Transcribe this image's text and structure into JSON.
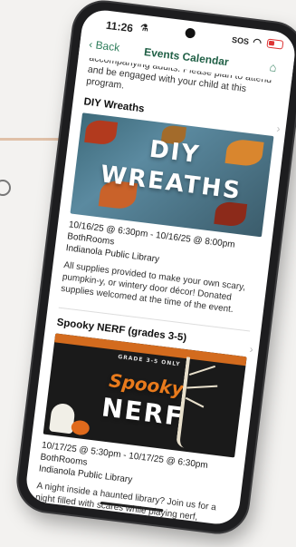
{
  "status": {
    "time": "11:26",
    "sos": "SOS"
  },
  "nav": {
    "back": "Back",
    "title": "Events Calendar"
  },
  "intro_text": "accompanying adults. Please plan to attend and be engaged with your child at this program.",
  "events": [
    {
      "title": "DIY Wreaths",
      "banner_line1": "DIY",
      "banner_line2": "WREATHS",
      "datetime": "10/16/25 @ 6:30pm - 10/16/25 @ 8:00pm BothRooms",
      "location": "Indianola Public Library",
      "description": "All supplies provided to make your own scary, pumpkin-y, or wintery door décor! Donated supplies welcomed at the time of the event."
    },
    {
      "title": "Spooky NERF (grades 3-5)",
      "banner_small": "GRADE 3-5 ONLY",
      "banner_line1": "Spooky",
      "banner_line2": "NERF",
      "datetime": "10/17/25 @ 5:30pm - 10/17/25 @ 6:30pm BothRooms",
      "location": "Indianola Public Library",
      "description": "A night inside a haunted library? Join us for a night filled with scares while playing nerf, costumes are"
    }
  ],
  "colors": {
    "accent": "#2e7d5b",
    "title": "#1f5f45"
  }
}
